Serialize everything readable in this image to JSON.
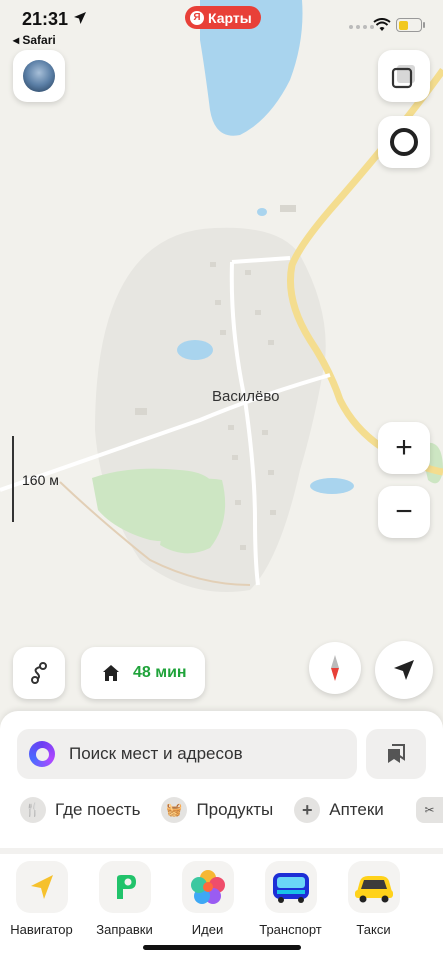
{
  "status_bar": {
    "time": "21:31",
    "back_app": "◂ Safari",
    "battery_level": 0.45
  },
  "brand": {
    "mark": "Я",
    "title": "Карты",
    "color": "#e84038"
  },
  "map": {
    "place_name": "Василёво",
    "scale_label": "160 м"
  },
  "controls": {
    "layers_icon": "layers-icon",
    "alice_icon": "alice-ring-icon",
    "zoom_in": "+",
    "zoom_out": "−",
    "compass_icon": "compass-icon",
    "locate_icon": "navigation-arrow-icon",
    "route_icon": "route-icon"
  },
  "commute": {
    "icon": "home-icon",
    "time": "48 мин",
    "color": "#1fa33a"
  },
  "search": {
    "placeholder": "Поиск мест и адресов",
    "bookmarks_icon": "bookmarks-icon"
  },
  "categories": [
    {
      "label": "Где поесть",
      "icon": "fork-knife-icon"
    },
    {
      "label": "Продукты",
      "icon": "basket-icon"
    },
    {
      "label": "Аптеки",
      "icon": "plus-icon"
    }
  ],
  "apps": [
    {
      "label": "Навигатор",
      "icon": "navigator-icon"
    },
    {
      "label": "Заправки",
      "icon": "fuel-icon"
    },
    {
      "label": "Идеи",
      "icon": "ideas-icon"
    },
    {
      "label": "Транспорт",
      "icon": "bus-icon"
    },
    {
      "label": "Такси",
      "icon": "taxi-icon"
    }
  ]
}
